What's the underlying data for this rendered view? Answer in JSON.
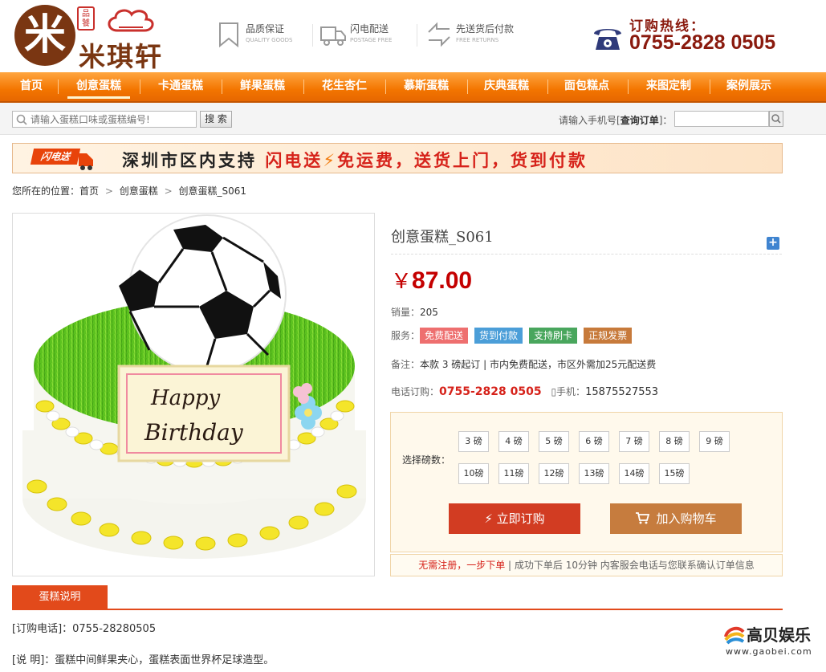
{
  "header": {
    "logo_char": "米",
    "logo_badge": "品饕",
    "logo_name": "米琪轩",
    "promises": [
      {
        "title": "品质保证",
        "sub": "QUALITY GOODS",
        "icon": "bookmark-icon"
      },
      {
        "title": "闪电配送",
        "sub": "POSTAGE FREE",
        "icon": "truck-icon"
      },
      {
        "title": "先送货后付款",
        "sub": "FREE RETURNS",
        "icon": "exchange-icon"
      }
    ],
    "hotline_label": "订购热线：",
    "hotline_number": "0755-2828 0505"
  },
  "nav": {
    "items": [
      "首页",
      "创意蛋糕",
      "卡通蛋糕",
      "鲜果蛋糕",
      "花生杏仁",
      "慕斯蛋糕",
      "庆典蛋糕",
      "面包糕点",
      "来图定制",
      "案例展示"
    ],
    "active_index": 1
  },
  "search": {
    "placeholder": "请输入蛋糕口味或蛋糕编号!",
    "button": "搜 索",
    "order_label_prefix": "请输入手机号[",
    "order_label_bold": "查询订单",
    "order_label_suffix": "]："
  },
  "banner": {
    "truck_text": "闪电送",
    "text_1": "深圳市区内支持",
    "text_2": "闪电送",
    "bolt": "⚡",
    "text_3": "免运费，送货上门，货到付款"
  },
  "breadcrumb": {
    "prefix": "您所在的位置：",
    "items": [
      "首页",
      "创意蛋糕",
      "创意蛋糕_S061"
    ],
    "separator": ">"
  },
  "product": {
    "title": "创意蛋糕_S061",
    "currency": "￥",
    "price": "87.00",
    "sales_label": "销量：",
    "sales_value": "205",
    "service_label": "服务：",
    "services": [
      "免费配送",
      "货到付款",
      "支持刷卡",
      "正规发票"
    ],
    "note_label": "备注：",
    "note_value": "本款 3 磅起订 | 市内免费配送，市区外需加25元配送费",
    "phone_label": "电话订购：",
    "phone_value": "0755-2828 0505",
    "mobile_label": "手机：",
    "mobile_value": "15875527553",
    "cake_text_1": "Happy",
    "cake_text_2": "Birthday"
  },
  "options": {
    "label": "选择磅数：",
    "sizes": [
      "3 磅",
      "4 磅",
      "5 磅",
      "6 磅",
      "7 磅",
      "8 磅",
      "9 磅",
      "10磅",
      "11磅",
      "12磅",
      "13磅",
      "14磅",
      "15磅"
    ],
    "buy_label": "立即订购",
    "cart_label": "加入购物车",
    "notice_red": "无需注册，一步下单",
    "notice_rest": " | 成功下单后 10分钟 内客服会电话与您联系确认订单信息"
  },
  "description": {
    "tab": "蛋糕说明",
    "line_1": "[订购电话]：0755-28280505",
    "line_2": "[说 明]：蛋糕中间鲜果夹心，蛋糕表面世界杯足球造型。"
  },
  "watermark": {
    "name": "高贝娱乐",
    "url": "www.gaobei.com"
  },
  "colors": {
    "nav_orange": "#f37500",
    "price_red": "#c40000",
    "buy_red": "#d23c22",
    "cart_brown": "#c67c3e",
    "brand_brown": "#7a3612"
  }
}
